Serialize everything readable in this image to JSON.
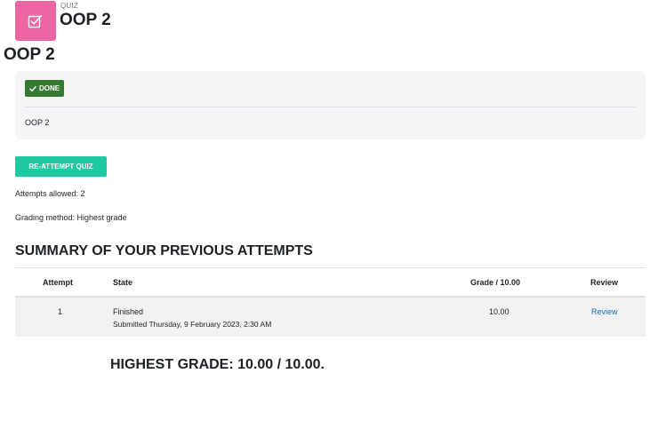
{
  "activity": {
    "kicker": "QUIZ",
    "header_title": "OOP 2",
    "icon": "checkbox-edit-icon",
    "icon_color": "#eb66a2"
  },
  "page_title": "OOP 2",
  "completion": {
    "badge_label": "DONE",
    "badge_color": "#357a32",
    "description": "OOP 2"
  },
  "actions": {
    "reattempt_label": "RE-ATTEMPT QUIZ",
    "button_color": "#20c9a0"
  },
  "quiz_info": {
    "attempts_allowed": "Attempts allowed: 2",
    "grading_method": "Grading method: Highest grade"
  },
  "summary": {
    "heading": "SUMMARY OF YOUR PREVIOUS ATTEMPTS",
    "columns": [
      "Attempt",
      "State",
      "Grade / 10.00",
      "Review"
    ],
    "rows": [
      {
        "attempt": "1",
        "state": "Finished",
        "submitted": "Submitted Thursday, 9 February 2023, 2:30 AM",
        "grade": "10.00",
        "review": "Review"
      }
    ]
  },
  "highest_grade": "HIGHEST GRADE: 10.00 / 10.00.",
  "link_color": "#0f6cbf"
}
